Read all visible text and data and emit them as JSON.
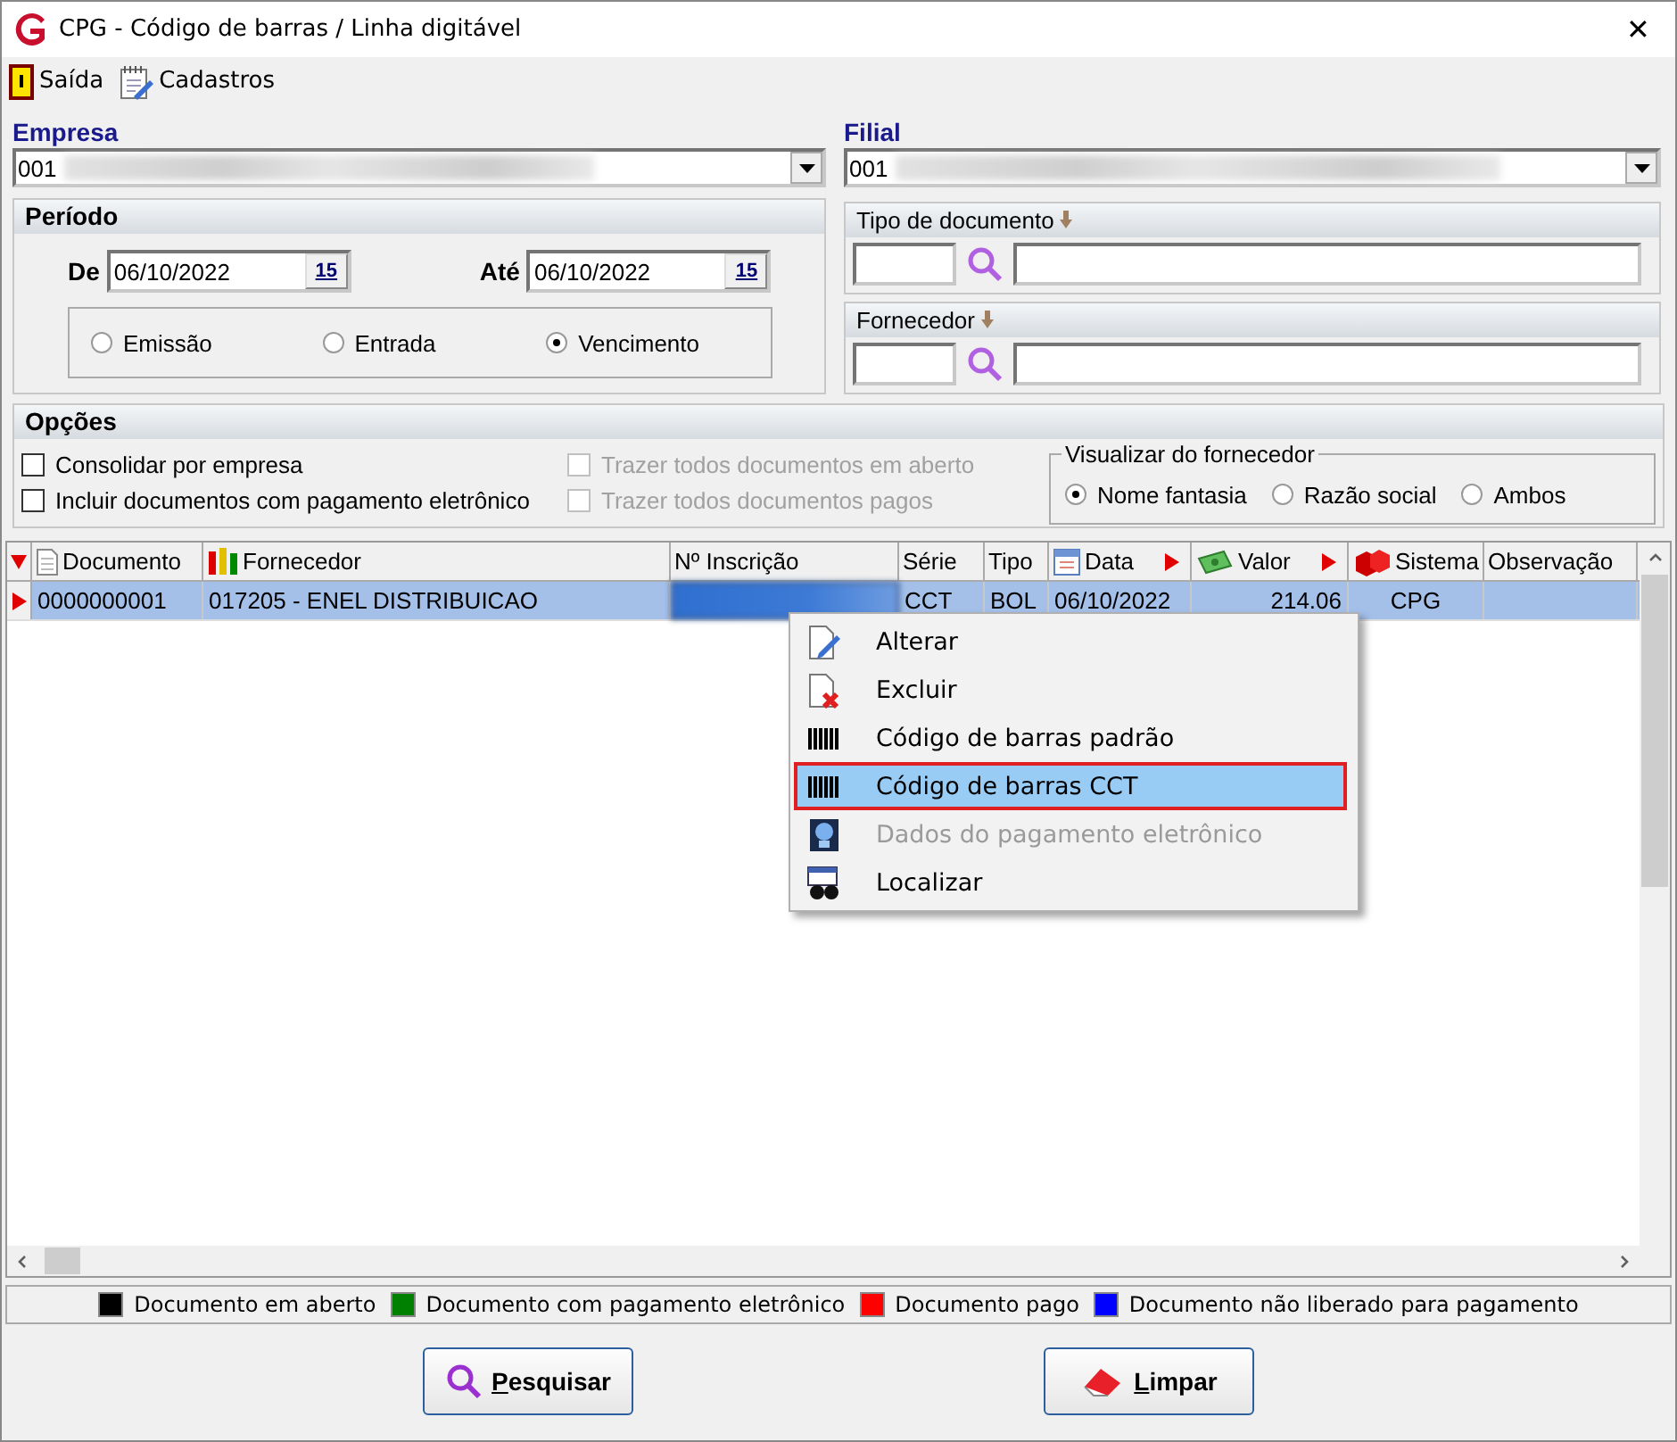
{
  "window": {
    "title": "CPG - Código de barras / Linha digitável",
    "close": "✕"
  },
  "toolbar": [
    {
      "kind": "exit",
      "label": "Saída"
    },
    {
      "kind": "register",
      "label": "Cadastros"
    }
  ],
  "empresa": {
    "label": "Empresa",
    "value": "001"
  },
  "filial": {
    "label": "Filial",
    "value": "001"
  },
  "periodo": {
    "title": "Período",
    "from_label": "De",
    "from_value": "06/10/2022",
    "to_label": "Até",
    "to_value": "06/10/2022",
    "from_calendar": "15",
    "to_calendar": "15",
    "date_types": [
      {
        "label": "Emissão",
        "selected": false
      },
      {
        "label": "Entrada",
        "selected": false
      },
      {
        "label": "Vencimento",
        "selected": true
      }
    ]
  },
  "tipo_documento": {
    "label": "Tipo de documento"
  },
  "fornecedor": {
    "label": "Fornecedor"
  },
  "opcoes": {
    "title": "Opções",
    "checkboxes": [
      {
        "label": "Consolidar por empresa",
        "checked": false,
        "disabled": false
      },
      {
        "label": "Trazer todos documentos em aberto",
        "checked": false,
        "disabled": true
      },
      {
        "label": "Incluir documentos com pagamento eletrônico",
        "checked": false,
        "disabled": false
      },
      {
        "label": "Trazer todos documentos pagos",
        "checked": false,
        "disabled": true
      }
    ],
    "visualizar": {
      "title": "Visualizar do fornecedor",
      "options": [
        {
          "label": "Nome fantasia",
          "selected": true
        },
        {
          "label": "Razão social",
          "selected": false
        },
        {
          "label": "Ambos",
          "selected": false
        }
      ]
    }
  },
  "table": {
    "columns": [
      {
        "kind": "document",
        "label": "Documento",
        "sort_marker": false
      },
      {
        "kind": "supplier",
        "label": "Fornecedor",
        "sort_marker": false
      },
      {
        "kind": "plain",
        "label": "Nº Inscrição",
        "sort_marker": false
      },
      {
        "kind": "plain",
        "label": "Série",
        "sort_marker": false
      },
      {
        "kind": "plain",
        "label": "Tipo",
        "sort_marker": false
      },
      {
        "kind": "date",
        "label": "Data",
        "sort_marker": true
      },
      {
        "kind": "value",
        "label": "Valor",
        "sort_marker": true
      },
      {
        "kind": "system",
        "label": "Sistema",
        "sort_marker": false
      },
      {
        "kind": "plain",
        "label": "Observação",
        "sort_marker": false
      }
    ],
    "rows": [
      {
        "selected": true,
        "cells": [
          {
            "kind": "text",
            "text": "0000000001"
          },
          {
            "kind": "text",
            "text": "017205 - ENEL DISTRIBUICAO"
          },
          {
            "kind": "redacted"
          },
          {
            "kind": "text",
            "text": "CCT"
          },
          {
            "kind": "text",
            "text": "BOL"
          },
          {
            "kind": "text",
            "text": "06/10/2022"
          },
          {
            "kind": "number",
            "text": "214.06"
          },
          {
            "kind": "center",
            "text": "CPG"
          },
          {
            "kind": "empty"
          }
        ]
      }
    ]
  },
  "context_menu": [
    {
      "kind": "edit",
      "label": "Alterar",
      "disabled": false,
      "selected": false
    },
    {
      "kind": "delete",
      "label": "Excluir",
      "disabled": false,
      "selected": false
    },
    {
      "kind": "barcode",
      "label": "Código de barras padrão",
      "disabled": false,
      "selected": false
    },
    {
      "kind": "barcode",
      "label": "Código de barras CCT",
      "disabled": false,
      "selected": true
    },
    {
      "kind": "monitor",
      "label": "Dados do pagamento eletrônico",
      "disabled": true,
      "selected": false
    },
    {
      "kind": "find",
      "label": "Localizar",
      "disabled": false,
      "selected": false
    }
  ],
  "legend": [
    {
      "label": "Documento em aberto",
      "color": "#000000"
    },
    {
      "label": "Documento com pagamento eletrônico",
      "color": "#008000"
    },
    {
      "label": "Documento pago",
      "color": "#ff0000"
    },
    {
      "label": "Documento não liberado para pagamento",
      "color": "#0000ff"
    }
  ],
  "buttons": [
    {
      "kind": "search",
      "label": "Pesquisar"
    },
    {
      "kind": "clear",
      "label": "Limpar"
    }
  ]
}
